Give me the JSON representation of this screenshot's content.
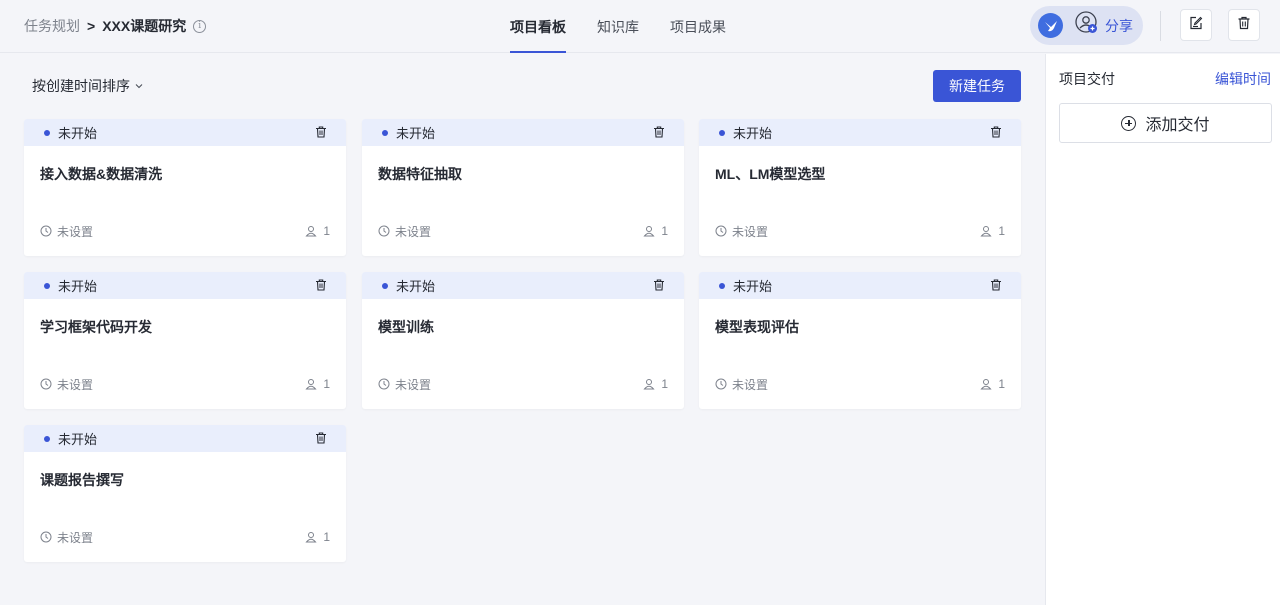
{
  "breadcrumb": {
    "parent": "任务规划",
    "separator": ">",
    "current": "XXX课题研究",
    "info_icon": "info-circle-icon"
  },
  "tabs": [
    {
      "label": "项目看板",
      "active": true
    },
    {
      "label": "知识库",
      "active": false
    },
    {
      "label": "项目成果",
      "active": false
    }
  ],
  "header_actions": {
    "logo_icon": "bird-logo-icon",
    "share_icon": "user-add-icon",
    "share_label": "分享",
    "edit_icon": "edit-icon",
    "delete_icon": "trash-icon"
  },
  "toolbar": {
    "sort_label": "按创建时间排序",
    "new_task_label": "新建任务"
  },
  "tasks": [
    {
      "status": "未开始",
      "title": "接入数据&数据清洗",
      "due": "未设置",
      "members": "1"
    },
    {
      "status": "未开始",
      "title": "数据特征抽取",
      "due": "未设置",
      "members": "1"
    },
    {
      "status": "未开始",
      "title": "ML、LM模型选型",
      "due": "未设置",
      "members": "1"
    },
    {
      "status": "未开始",
      "title": "学习框架代码开发",
      "due": "未设置",
      "members": "1"
    },
    {
      "status": "未开始",
      "title": "模型训练",
      "due": "未设置",
      "members": "1"
    },
    {
      "status": "未开始",
      "title": "模型表现评估",
      "due": "未设置",
      "members": "1"
    },
    {
      "status": "未开始",
      "title": "课题报告撰写",
      "due": "未设置",
      "members": "1"
    }
  ],
  "deliverables": {
    "title": "项目交付",
    "edit_time_label": "编辑时间",
    "add_label": "添加交付"
  },
  "colors": {
    "accent": "#3a55d6",
    "card_header": "#e9eefc",
    "background": "#f4f5f9"
  }
}
